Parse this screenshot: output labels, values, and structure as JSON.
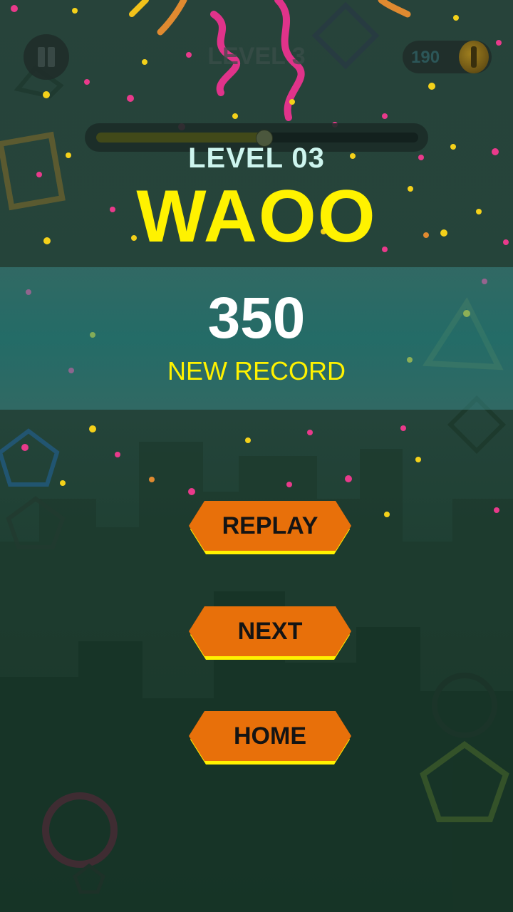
{
  "hud": {
    "level_faint": "LEVEL 3",
    "coins": "190",
    "progress": 0.52
  },
  "result": {
    "level_label": "LEVEL 03",
    "title": "WAOO",
    "score": "350",
    "record_label": "NEW RECORD"
  },
  "buttons": {
    "replay": "REPLAY",
    "next": "NEXT",
    "home": "HOME"
  },
  "icons": {
    "pause": "pause-icon",
    "coin": "coin-icon"
  },
  "colors": {
    "title": "#fff200",
    "button_fill": "#e8700a",
    "button_edge": "#fff200"
  }
}
